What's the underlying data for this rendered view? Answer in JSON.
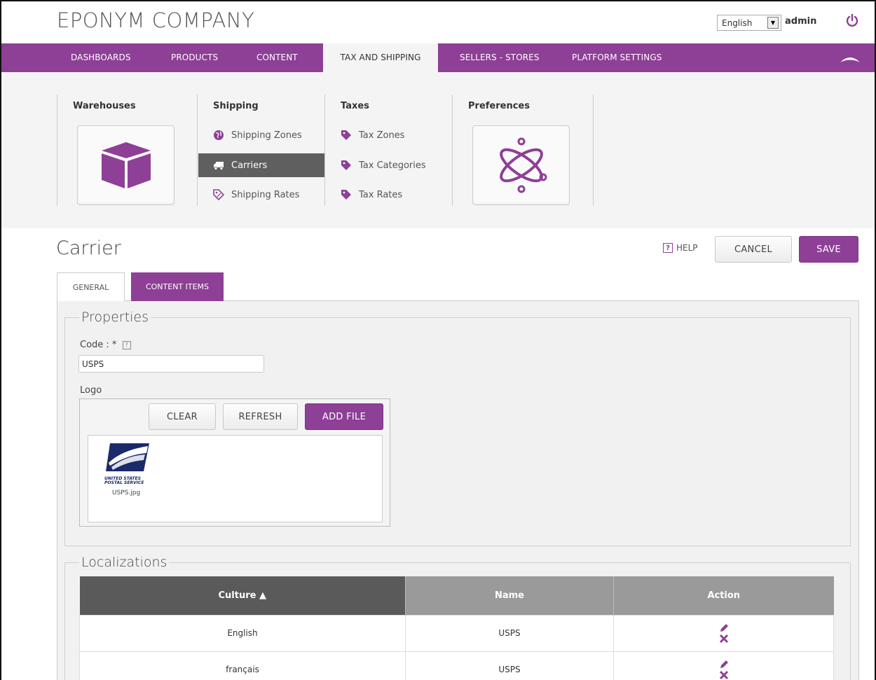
{
  "header": {
    "brand": "EPONYM COMPANY",
    "language": "English",
    "user": "admin"
  },
  "nav": {
    "items": [
      "DASHBOARDS",
      "PRODUCTS",
      "CONTENT",
      "TAX AND SHIPPING",
      "SELLERS - STORES",
      "PLATFORM SETTINGS"
    ],
    "active": "TAX AND SHIPPING"
  },
  "submenu": {
    "warehouses": {
      "title": "Warehouses"
    },
    "shipping": {
      "title": "Shipping",
      "links": [
        "Shipping Zones",
        "Carriers",
        "Shipping Rates"
      ],
      "selected": "Carriers"
    },
    "taxes": {
      "title": "Taxes",
      "links": [
        "Tax Zones",
        "Tax Categories",
        "Tax Rates"
      ]
    },
    "preferences": {
      "title": "Preferences"
    }
  },
  "page": {
    "title": "Carrier",
    "help": "HELP",
    "cancel": "CANCEL",
    "save": "SAVE"
  },
  "tabs": [
    "GENERAL",
    "CONTENT ITEMS"
  ],
  "properties": {
    "legend": "Properties",
    "code_label": "Code : *",
    "code_value": "USPS",
    "logo_label": "Logo",
    "clear": "CLEAR",
    "refresh": "REFRESH",
    "add_file": "ADD FILE",
    "logo_text": "UNITED STATES POSTAL SERVICE",
    "file_name": "USPS.jpg"
  },
  "localizations": {
    "legend": "Localizations",
    "columns": [
      "Culture ▲",
      "Name",
      "Action"
    ],
    "rows": [
      {
        "culture": "English",
        "name": "USPS"
      },
      {
        "culture": "français",
        "name": "USPS"
      }
    ]
  },
  "colors": {
    "accent": "#8e3f96",
    "dark": "#5f5f5f"
  }
}
